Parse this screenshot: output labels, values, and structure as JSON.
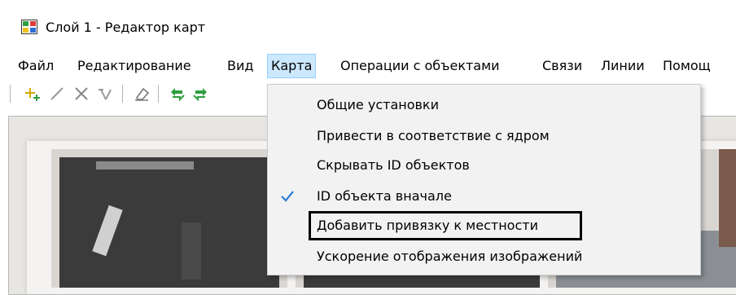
{
  "window": {
    "title": "Слой 1 - Редактор карт"
  },
  "menubar": {
    "items": [
      {
        "label": "Файл"
      },
      {
        "label": "Редактирование"
      },
      {
        "label": "Вид"
      },
      {
        "label": "Карта"
      },
      {
        "label": "Операции с объектами"
      },
      {
        "label": "Связи"
      },
      {
        "label": "Линии"
      },
      {
        "label": "Помощ"
      }
    ],
    "active": "Карта"
  },
  "toolbar": {
    "icons": [
      "add-point-icon",
      "draw-line-icon",
      "delete-icon",
      "move-point-icon",
      "eraser-icon",
      "undo-icon",
      "redo-icon"
    ]
  },
  "dropdown": {
    "items": [
      {
        "label": "Общие установки",
        "checked": false,
        "highlighted": false
      },
      {
        "label": "Привести в соответствие с ядром",
        "checked": false,
        "highlighted": false
      },
      {
        "label": "Скрывать ID объектов",
        "checked": false,
        "highlighted": false
      },
      {
        "label": "ID объекта вначале",
        "checked": true,
        "highlighted": false
      },
      {
        "label": "Добавить привязку к местности",
        "checked": false,
        "highlighted": true
      },
      {
        "label": "Ускорение отображения изображений",
        "checked": false,
        "highlighted": false
      }
    ]
  },
  "colors": {
    "menu_active_bg": "#cce8ff",
    "check_color": "#2b7bd6",
    "highlight_border": "#000000"
  }
}
